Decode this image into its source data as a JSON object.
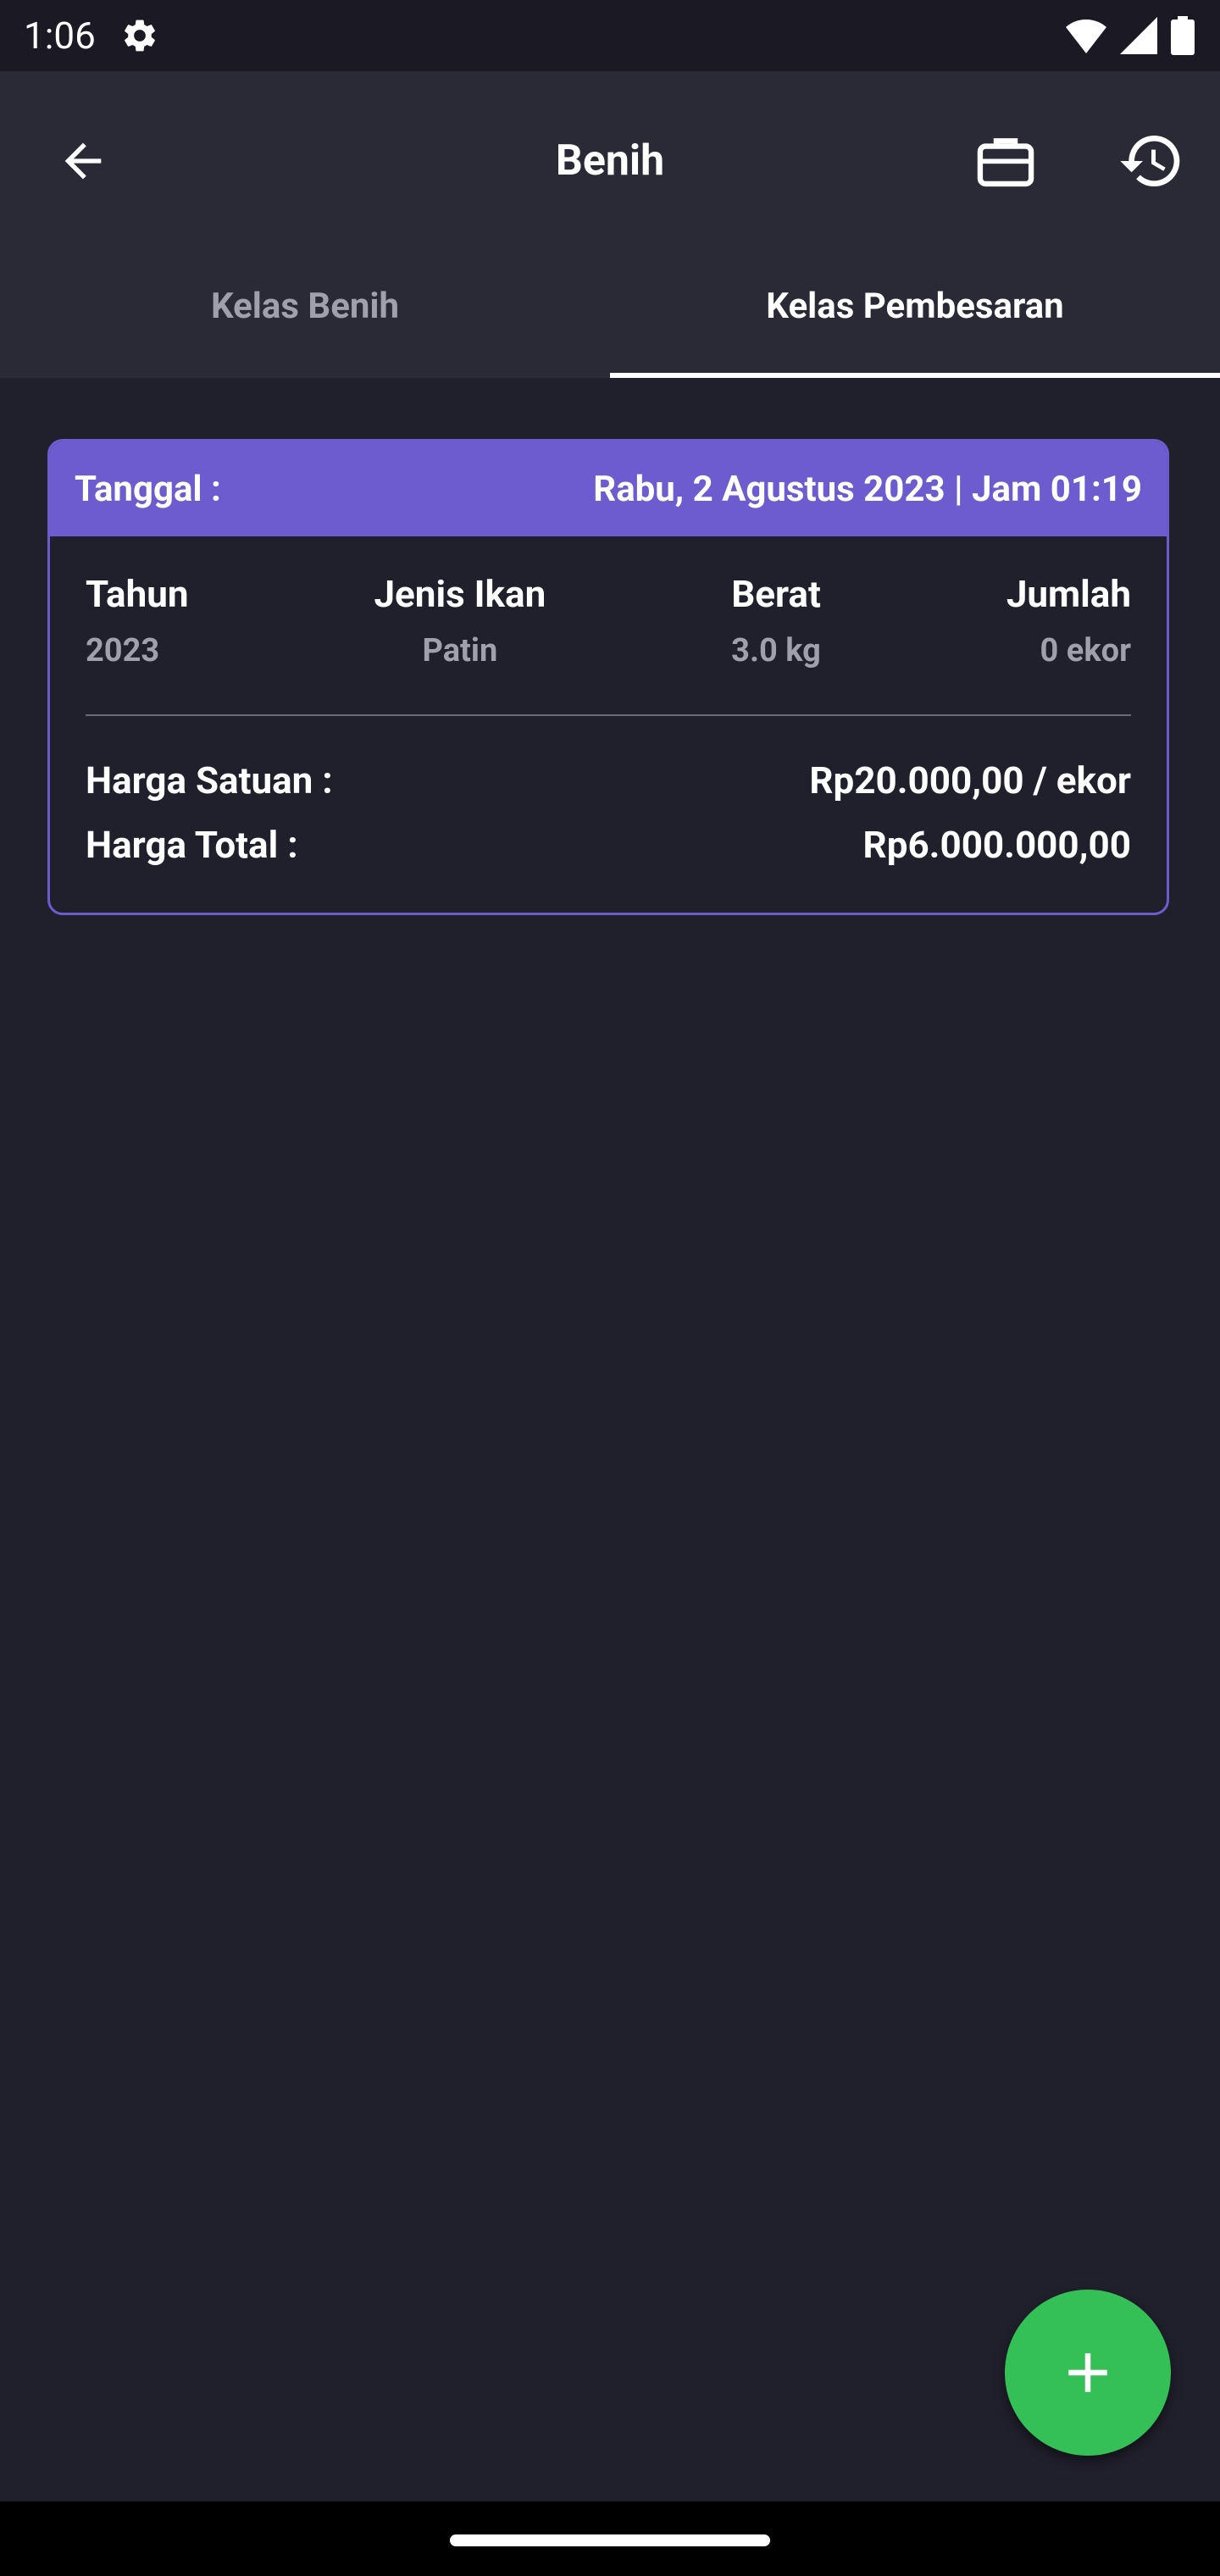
{
  "status_bar": {
    "time": "1:06",
    "icons": [
      "gear-icon",
      "wifi-icon",
      "signal-icon",
      "battery-icon"
    ]
  },
  "app_bar": {
    "title": "Benih",
    "icons": [
      "arrow-back-icon",
      "briefcase-icon",
      "history-icon"
    ]
  },
  "tabs": [
    {
      "label": "Kelas Benih",
      "selected": false
    },
    {
      "label": "Kelas Pembesaran",
      "selected": true
    }
  ],
  "card": {
    "date_label": "Tanggal :",
    "date_value": "Rabu, 2 Agustus 2023 | Jam 01:19",
    "columns": [
      {
        "label": "Tahun",
        "value": "2023"
      },
      {
        "label": "Jenis Ikan",
        "value": "Patin"
      },
      {
        "label": "Berat",
        "value": "3.0 kg"
      },
      {
        "label": "Jumlah",
        "value": "0 ekor"
      }
    ],
    "unit_price_label": "Harga Satuan :",
    "unit_price_value": "Rp20.000,00 / ekor",
    "total_price_label": "Harga Total :",
    "total_price_value": "Rp6.000.000,00"
  },
  "fab": {
    "icon": "plus-icon"
  },
  "colors": {
    "background": "#201f2c",
    "app_bar": "#2a2936",
    "accent": "#6c5ccf",
    "fab": "#34c057",
    "muted_text": "#a09fac"
  }
}
